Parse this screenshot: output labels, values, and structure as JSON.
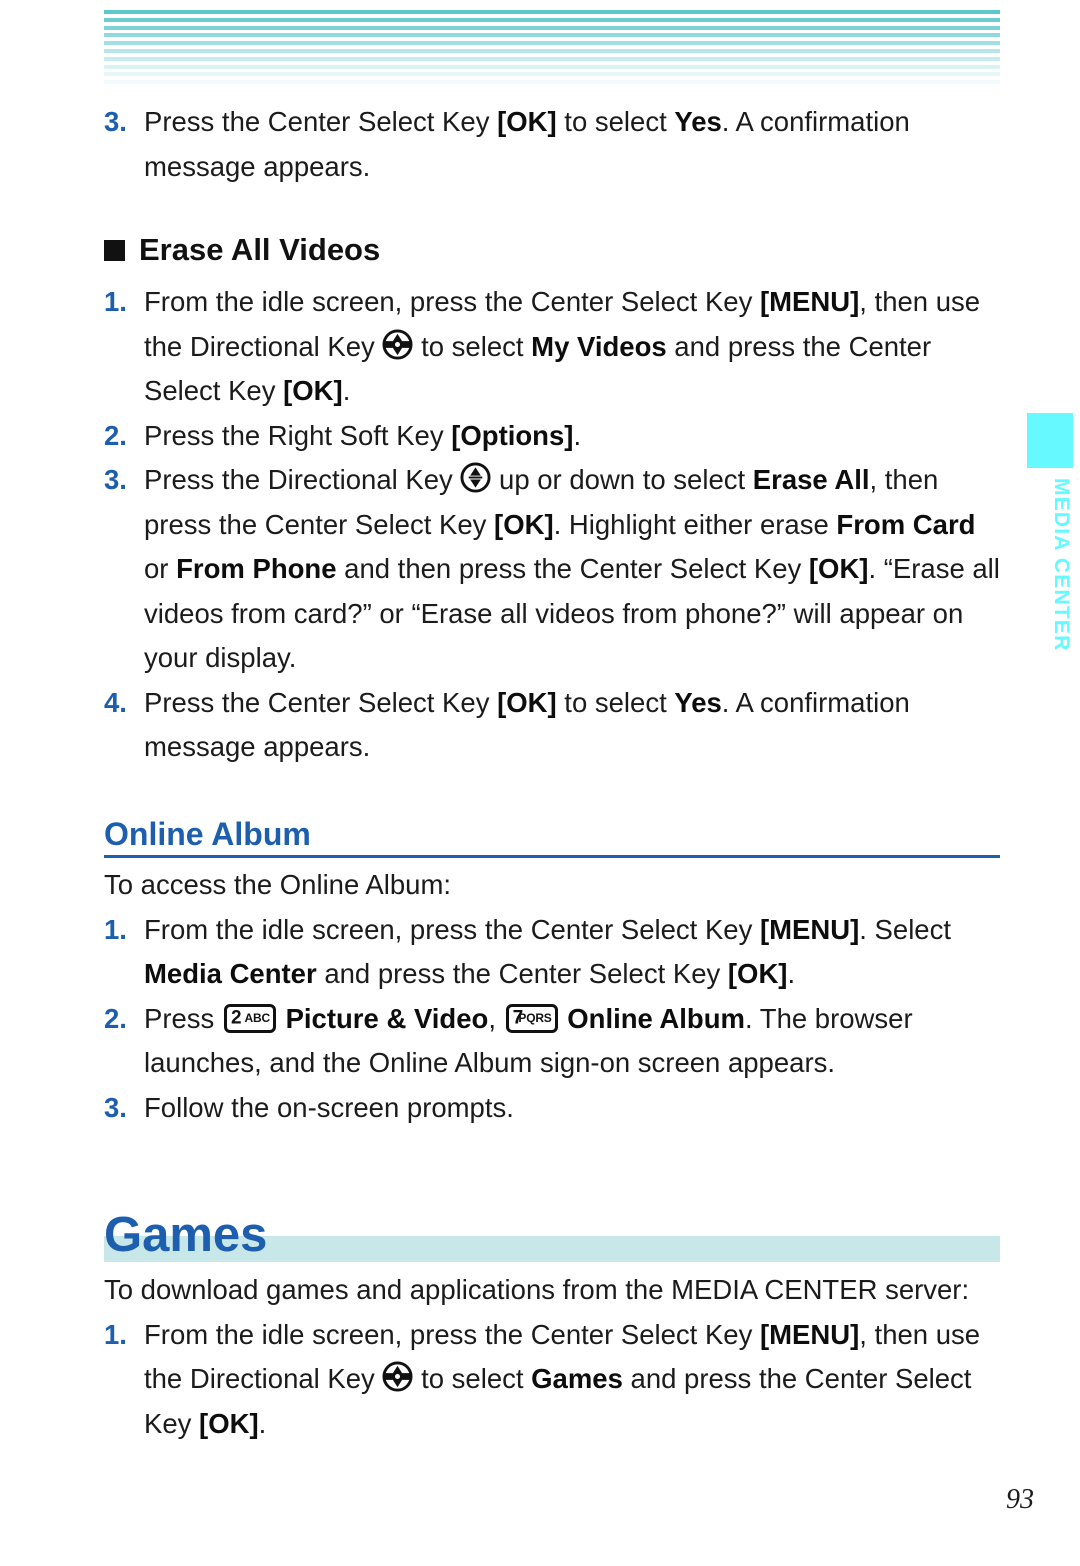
{
  "page": {
    "number": "93",
    "accent_blue": "#1D5FAE",
    "accent_teal": "#C7E7E8",
    "tab_cyan": "#66F9FF"
  },
  "side_tab": {
    "label": "MEDIA CENTER"
  },
  "header_decoration": {
    "name": "striped-band",
    "stripe_color": "#5FC8CE"
  },
  "top_step": {
    "num": "3.",
    "parts": [
      {
        "t": "Press the Center Select Key ",
        "b": false
      },
      {
        "t": "[OK]",
        "b": true
      },
      {
        "t": " to select ",
        "b": false
      },
      {
        "t": "Yes",
        "b": true
      },
      {
        "t": ". A confirmation message appears.",
        "b": false
      }
    ]
  },
  "erase_all_videos": {
    "heading": "Erase All Videos",
    "steps": [
      {
        "num": "1.",
        "parts": [
          {
            "t": "From the idle screen, press the Center Select Key ",
            "b": false
          },
          {
            "t": "[MENU]",
            "b": true
          },
          {
            "t": ", then use the Directional Key ",
            "b": false
          },
          {
            "icon": "directional-key-4way"
          },
          {
            "t": " to select ",
            "b": false
          },
          {
            "t": "My Videos",
            "b": true
          },
          {
            "t": " and press the Center Select Key ",
            "b": false
          },
          {
            "t": "[OK]",
            "b": true
          },
          {
            "t": ".",
            "b": false
          }
        ]
      },
      {
        "num": "2.",
        "parts": [
          {
            "t": "Press the Right Soft Key ",
            "b": false
          },
          {
            "t": "[Options]",
            "b": true
          },
          {
            "t": ".",
            "b": false
          }
        ]
      },
      {
        "num": "3.",
        "parts": [
          {
            "t": "Press the Directional Key ",
            "b": false
          },
          {
            "icon": "directional-key-updown"
          },
          {
            "t": " up or down to select ",
            "b": false
          },
          {
            "t": "Erase All",
            "b": true
          },
          {
            "t": ", then press the Center Select Key ",
            "b": false
          },
          {
            "t": "[OK]",
            "b": true
          },
          {
            "t": ". Highlight either erase ",
            "b": false
          },
          {
            "t": "From Card",
            "b": true
          },
          {
            "t": " or ",
            "b": false
          },
          {
            "t": "From Phone",
            "b": true
          },
          {
            "t": " and then press the Center Select Key ",
            "b": false
          },
          {
            "t": "[OK]",
            "b": true
          },
          {
            "t": ". “Erase all videos from card?” or “Erase all videos from phone?” will appear on your display.",
            "b": false
          }
        ]
      },
      {
        "num": "4.",
        "parts": [
          {
            "t": "Press the Center Select Key ",
            "b": false
          },
          {
            "t": "[OK]",
            "b": true
          },
          {
            "t": " to select ",
            "b": false
          },
          {
            "t": "Yes",
            "b": true
          },
          {
            "t": ". A confirmation message appears.",
            "b": false
          }
        ]
      }
    ]
  },
  "online_album": {
    "heading": "Online Album",
    "intro": "To access the Online Album:",
    "steps": [
      {
        "num": "1.",
        "parts": [
          {
            "t": "From the idle screen, press the Center Select Key ",
            "b": false
          },
          {
            "t": "[MENU]",
            "b": true
          },
          {
            "t": ". Select ",
            "b": false
          },
          {
            "t": "Media Center",
            "b": true
          },
          {
            "t": " and press the Center Select Key ",
            "b": false
          },
          {
            "t": "[OK]",
            "b": true
          },
          {
            "t": ".",
            "b": false
          }
        ]
      },
      {
        "num": "2.",
        "parts": [
          {
            "t": "Press ",
            "b": false
          },
          {
            "icon": "keypad-key",
            "digit": "2",
            "letters": "ABC"
          },
          {
            "t": " ",
            "b": false
          },
          {
            "t": "Picture & Video",
            "b": true
          },
          {
            "t": ", ",
            "b": false
          },
          {
            "icon": "keypad-key",
            "digit": "7",
            "letters": "PQRS"
          },
          {
            "t": " ",
            "b": false
          },
          {
            "t": "Online Album",
            "b": true
          },
          {
            "t": ". The browser launches, and the Online Album sign-on screen appears.",
            "b": false
          }
        ]
      },
      {
        "num": "3.",
        "parts": [
          {
            "t": "Follow the on-screen prompts.",
            "b": false
          }
        ]
      }
    ]
  },
  "games": {
    "heading": "Games",
    "intro": "To download games and applications from the MEDIA CENTER server:",
    "steps": [
      {
        "num": "1.",
        "parts": [
          {
            "t": "From the idle screen, press the Center Select Key ",
            "b": false
          },
          {
            "t": "[MENU]",
            "b": true
          },
          {
            "t": ", then use the Directional Key ",
            "b": false
          },
          {
            "icon": "directional-key-4way"
          },
          {
            "t": " to select ",
            "b": false
          },
          {
            "t": "Games",
            "b": true
          },
          {
            "t": " and press the Center Select Key ",
            "b": false
          },
          {
            "t": "[OK]",
            "b": true
          },
          {
            "t": ".",
            "b": false
          }
        ]
      }
    ]
  }
}
